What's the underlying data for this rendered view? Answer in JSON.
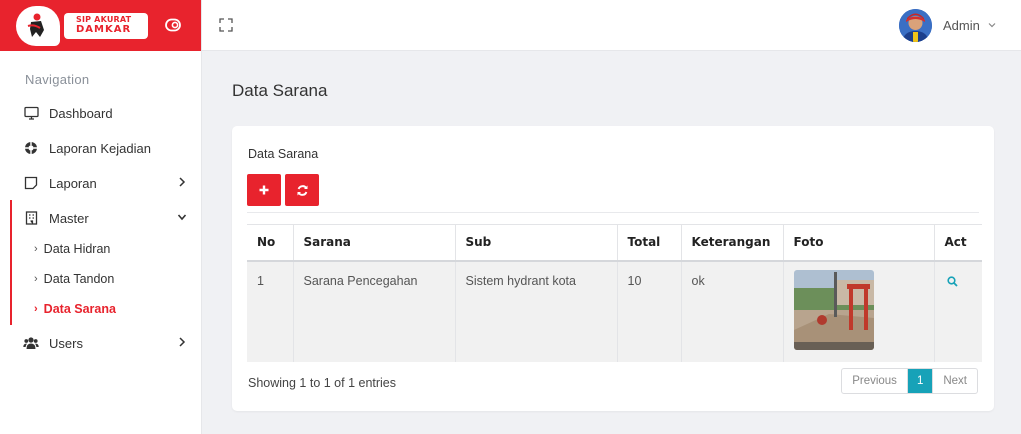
{
  "brand": {
    "line1": "SIP AKURAT",
    "line2": "DAMKAR",
    "color": "#e8232d"
  },
  "header": {
    "user_name": "Admin"
  },
  "sidebar": {
    "heading": "Navigation",
    "items": [
      {
        "label": "Dashboard",
        "icon": "monitor-icon"
      },
      {
        "label": "Laporan Kejadian",
        "icon": "lifebuoy-icon"
      },
      {
        "label": "Laporan",
        "icon": "square-icon"
      },
      {
        "label": "Master",
        "icon": "building-icon"
      }
    ],
    "master_children": [
      {
        "label": "Data Hidran",
        "active": false
      },
      {
        "label": "Data Tandon",
        "active": false
      },
      {
        "label": "Data Sarana",
        "active": true
      }
    ],
    "users": {
      "label": "Users",
      "icon": "users-icon"
    }
  },
  "page": {
    "title": "Data Sarana"
  },
  "card": {
    "title": "Data Sarana"
  },
  "table": {
    "columns": [
      "No",
      "Sarana",
      "Sub",
      "Total",
      "Keterangan",
      "Foto",
      "Act"
    ],
    "rows": [
      {
        "no": "1",
        "sarana": "Sarana Pencegahan",
        "sub": "Sistem hydrant kota",
        "total": "10",
        "keterangan": "ok"
      }
    ]
  },
  "footer": {
    "info": "Showing 1 to 1 of 1 entries",
    "prev": "Previous",
    "page": "1",
    "next": "Next"
  },
  "colors": {
    "accent": "#e8232d",
    "pager_active": "#17a2b8"
  }
}
